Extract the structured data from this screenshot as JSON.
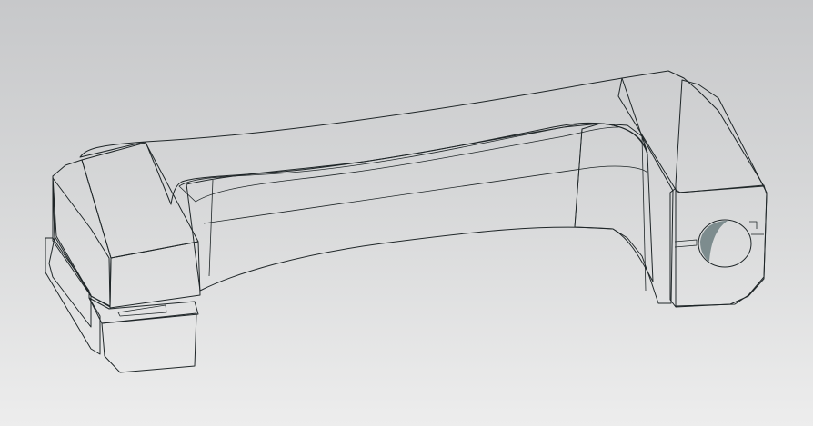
{
  "viewport": {
    "background_top": "#c7c8ca",
    "background_bottom": "#ededed"
  },
  "model": {
    "top_face_color": "#c6dde3",
    "side_face_color": "#667577",
    "dark_face_color": "#5d6c6e",
    "edge_color": "#1f2628"
  }
}
